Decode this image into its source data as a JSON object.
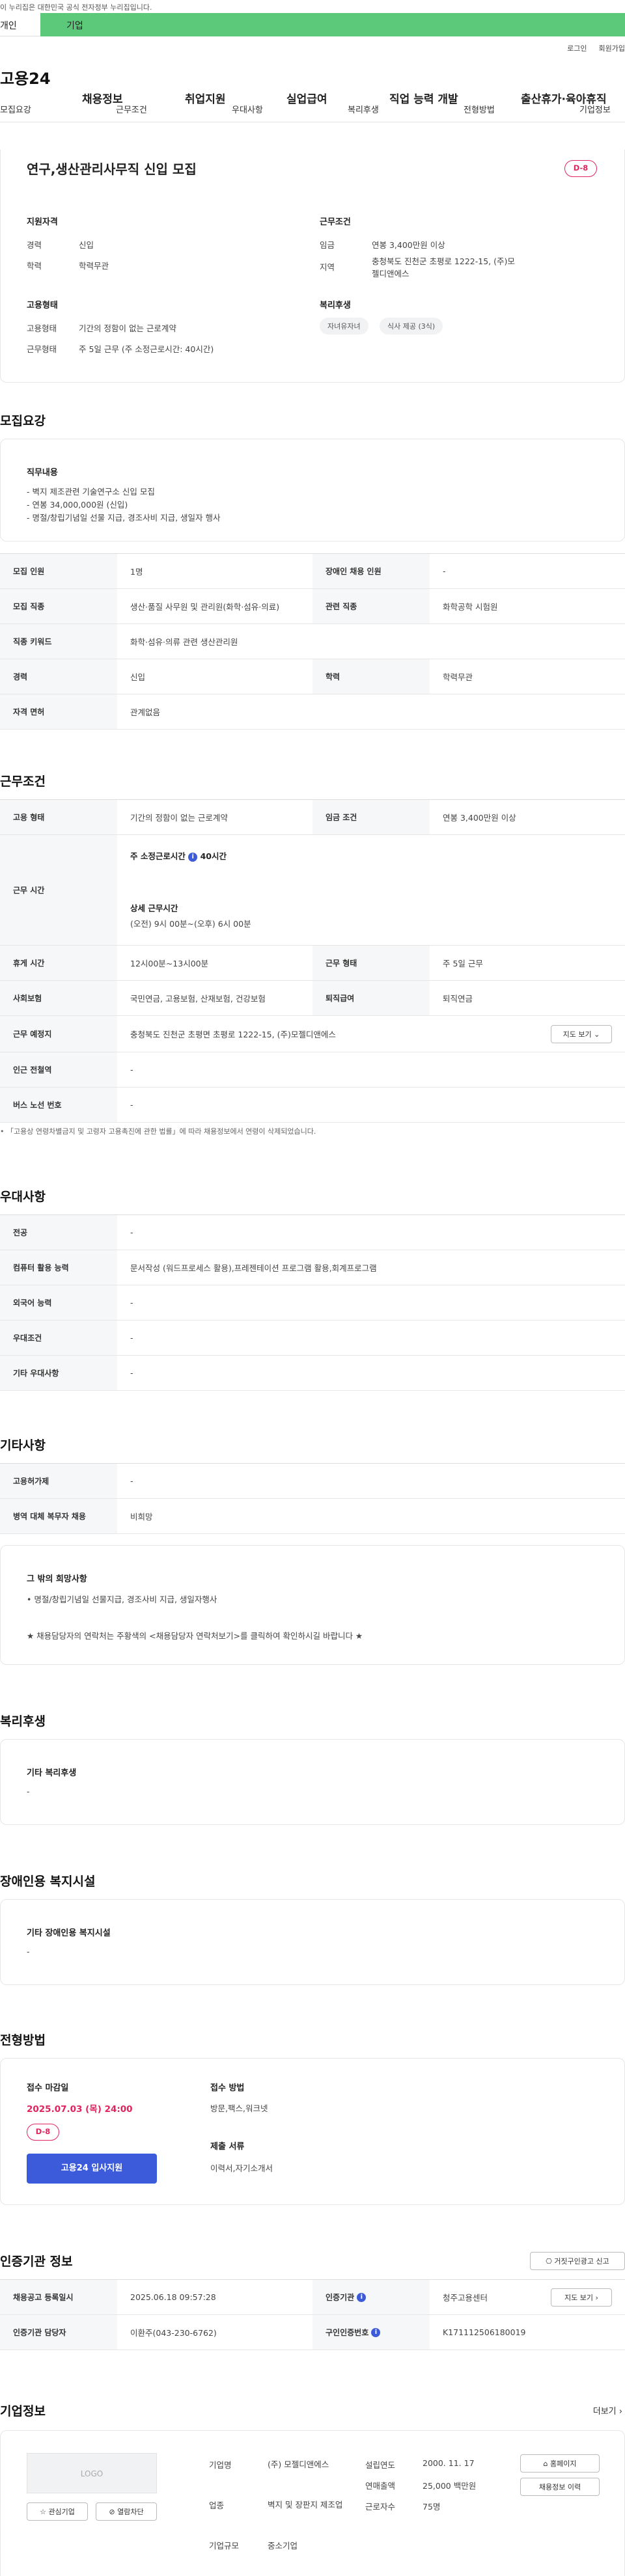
{
  "gov_banner": "이 누리집은 대한민국 공식 전자정부 누리집입니다.",
  "green_tabs": {
    "left": "개인",
    "right": "기업"
  },
  "util": {
    "login": "로그인",
    "join": "회원가입"
  },
  "gnb": {
    "logo": "고용24",
    "menu": [
      "채용정보",
      "취업지원",
      "실업급여",
      "직업 능력 개발",
      "출산휴가·육아휴직"
    ]
  },
  "tabs": [
    "모집요강",
    "근무조건",
    "우대사항",
    "복리후생",
    "전형방법",
    "기업정보"
  ],
  "summary": {
    "title": "연구,생산관리사무직 신입 모집",
    "dday": "D-8",
    "qual_title": "지원자격",
    "qual": [
      [
        "경력",
        "신입"
      ],
      [
        "학력",
        "학력무관"
      ]
    ],
    "emp_title": "고용형태",
    "emp": [
      [
        "고용형태",
        "기간의 정함이 없는 근로계약"
      ],
      [
        "근무형태",
        "주 5일 근무 (주 소정근로시간: 40시간)"
      ]
    ],
    "cond_title": "근무조건",
    "cond": [
      [
        "임금",
        "연봉 3,400만원 이상"
      ],
      [
        "지역",
        "충청북도 진천군 초평로 1222-15, (주)모젤디앤에스"
      ]
    ],
    "welfare_title": "복리후생",
    "welfare_tags": [
      "자녀유자녀",
      "식사 제공 (3식)"
    ]
  },
  "recruit": {
    "heading": "모집요강",
    "duty_title": "직무내용",
    "duty_lines": [
      "- 벽지 제조관련 기술연구소 신입 모집",
      "- 연봉 34,000,000원 (신입)",
      "- 명절/창립기념일 선물 지급, 경조사비 지급, 생일자 행사"
    ],
    "rows": [
      {
        "k1": "모집 인원",
        "v1": "1명",
        "k2": "장애인 채용 인원",
        "v2": "-"
      },
      {
        "k1": "모집 직종",
        "v1": "생산·품질 사무원 및 관리원(화학·섬유·의료)",
        "k2": "관련 직종",
        "v2": "화학공학 시험원"
      },
      {
        "k1": "직종 키워드",
        "v1": "화학·섬유·의류 관련 생산관리원"
      },
      {
        "k1": "경력",
        "v1": "신입",
        "k2": "학력",
        "v2": "학력무관"
      },
      {
        "k1": "자격 면허",
        "v1": "관계없음"
      }
    ]
  },
  "work": {
    "heading": "근무조건",
    "type_k": "고용 형태",
    "type_v": "기간의 정함이 없는 근로계약",
    "wage_k": "임금 조건",
    "wage_v": "연봉 3,400만원 이상",
    "hours_k": "근무 시간",
    "hours_std": "주 소정근로시간",
    "hours_std_v": "40시간",
    "hours_detail_t": "상세 근무시간",
    "hours_detail_v": "(오전) 9시 00분~(오후) 6시 00분",
    "rows": [
      {
        "k1": "휴게 시간",
        "v1": "12시00분~13시00분",
        "k2": "근무 형태",
        "v2": "주 5일 근무"
      },
      {
        "k1": "사회보험",
        "v1": "국민연금, 고용보험, 산재보험, 건강보험",
        "k2": "퇴직급여",
        "v2": "퇴직연금"
      }
    ],
    "place_k": "근무 예정지",
    "place_v": "충청북도 진천군 초평면 초평로 1222-15, (주)모젤디앤에스",
    "map_btn": "지도 보기",
    "station_k": "인근 전철역",
    "station_v": "-",
    "bus_k": "버스 노선 번호",
    "bus_v": "-",
    "note": "「고용상 연령차별금지 및 고령자 고용촉진에 관한 법률」에 따라 채용정보에서 연령이 삭제되었습니다."
  },
  "pref": {
    "heading": "우대사항",
    "rows": [
      [
        "전공",
        "-"
      ],
      [
        "컴퓨터 활용 능력",
        "문서작성 (워드프로세스 활용),프레젠테이션 프로그램 활용,회계프로그램"
      ],
      [
        "외국어 능력",
        "-"
      ],
      [
        "우대조건",
        "-"
      ],
      [
        "기타 우대사항",
        "-"
      ]
    ]
  },
  "etc": {
    "heading": "기타사항",
    "rows": [
      [
        "고용허가제",
        "-"
      ],
      [
        "병역 대체 복무자 채용",
        "비희망"
      ]
    ],
    "box_title": "그 밖의 희망사항",
    "box_lines": [
      "• 명절/창립기념일 선물지급, 경조사비 지급, 생일자행사",
      "★ 채용담당자의 연락처는 주황색의 <채용담당자 연락처보기>를 클릭하여 확인하시길 바랍니다 ★"
    ]
  },
  "welfare": {
    "heading": "복리후생",
    "title": "기타 복리후생",
    "value": "-"
  },
  "disabled": {
    "heading": "장애인용 복지시설",
    "title": "기타 장애인용 복지시설",
    "value": "-"
  },
  "screening": {
    "heading": "전형방법",
    "deadline_t": "접수 마감일",
    "deadline_v": "2025.07.03 (목) 24:00",
    "dday": "D-8",
    "apply_btn": "고용24 입사지원",
    "method_t": "접수 방법",
    "method_v": "방문,팩스,워크넷",
    "docs_t": "제출 서류",
    "docs_v": "이력서,자기소개서"
  },
  "cert": {
    "heading": "인증기관 정보",
    "report_btn": "거짓구인광고 신고",
    "reg_k": "채용공고 등록일시",
    "reg_v": "2025.06.18 09:57:28",
    "org_k": "인증기관",
    "org_v": "청주고용센터",
    "map_btn": "지도 보기",
    "staff_k": "인증기관 담당자",
    "staff_v": "이환주(043-230-6762)",
    "num_k": "구인인증번호",
    "num_v": "K171112506180019"
  },
  "company": {
    "heading": "기업정보",
    "more": "더보기",
    "logo_text": "LOGO",
    "fav_btn": "관심기업",
    "block_btn": "열람차단",
    "name_k": "기업명",
    "name_v": "(주) 모젤디앤에스",
    "industry_k": "업종",
    "industry_v": "벽지 및 장판지 제조업",
    "size_k": "기업규모",
    "size_v": "중소기업",
    "year_k": "설립연도",
    "year_v": "2000. 11. 17",
    "sales_k": "연매출액",
    "sales_v": "25,000 백만원",
    "emp_k": "근로자수",
    "emp_v": "75명",
    "home_btn": "홈페이지",
    "history_btn": "채용정보 이력"
  }
}
